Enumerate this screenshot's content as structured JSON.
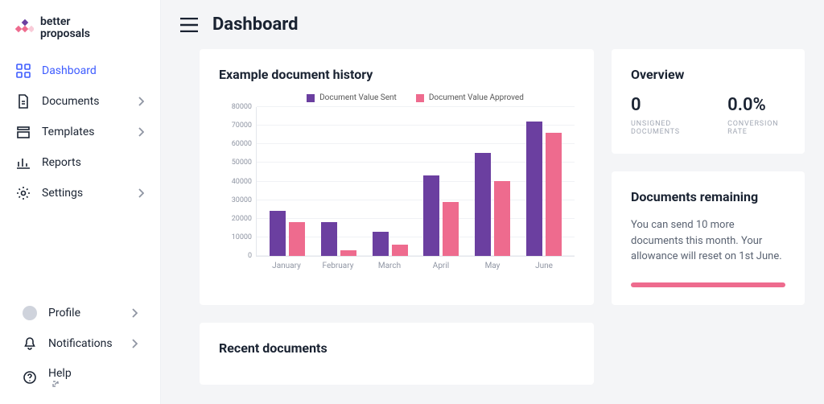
{
  "brand": "better\nproposals",
  "header": {
    "title": "Dashboard"
  },
  "sidebar": {
    "items": [
      {
        "label": "Dashboard",
        "icon": "grid-icon",
        "expandable": false,
        "active": true
      },
      {
        "label": "Documents",
        "icon": "document-icon",
        "expandable": true,
        "active": false
      },
      {
        "label": "Templates",
        "icon": "templates-icon",
        "expandable": true,
        "active": false
      },
      {
        "label": "Reports",
        "icon": "reports-icon",
        "expandable": false,
        "active": false
      },
      {
        "label": "Settings",
        "icon": "gear-icon",
        "expandable": true,
        "active": false
      }
    ],
    "bottom_items": [
      {
        "label": "Profile",
        "icon": "avatar-icon",
        "expandable": true
      },
      {
        "label": "Notifications",
        "icon": "bell-icon",
        "expandable": true
      },
      {
        "label": "Help",
        "icon": "help-icon",
        "expandable": false,
        "external": true
      }
    ]
  },
  "chart_card_title": "Example document history",
  "chart_data": {
    "type": "bar",
    "categories": [
      "January",
      "February",
      "March",
      "April",
      "May",
      "June"
    ],
    "series": [
      {
        "name": "Document Value Sent",
        "color": "#6b3fa0",
        "values": [
          24000,
          18000,
          13000,
          43000,
          55000,
          72000
        ]
      },
      {
        "name": "Document Value Approved",
        "color": "#ee6b8e",
        "values": [
          18000,
          3000,
          6000,
          29000,
          40000,
          66000
        ]
      }
    ],
    "ylim": [
      0,
      80000
    ],
    "ytick": 10000,
    "xlabel": "",
    "ylabel": ""
  },
  "overview": {
    "title": "Overview",
    "stats": [
      {
        "value": "0",
        "label": "UNSIGNED DOCUMENTS"
      },
      {
        "value": "0.0%",
        "label": "CONVERSION RATE"
      }
    ]
  },
  "remaining": {
    "title": "Documents remaining",
    "text": "You can send 10 more documents this month. Your allowance will reset on 1st June."
  },
  "recent_title": "Recent documents"
}
